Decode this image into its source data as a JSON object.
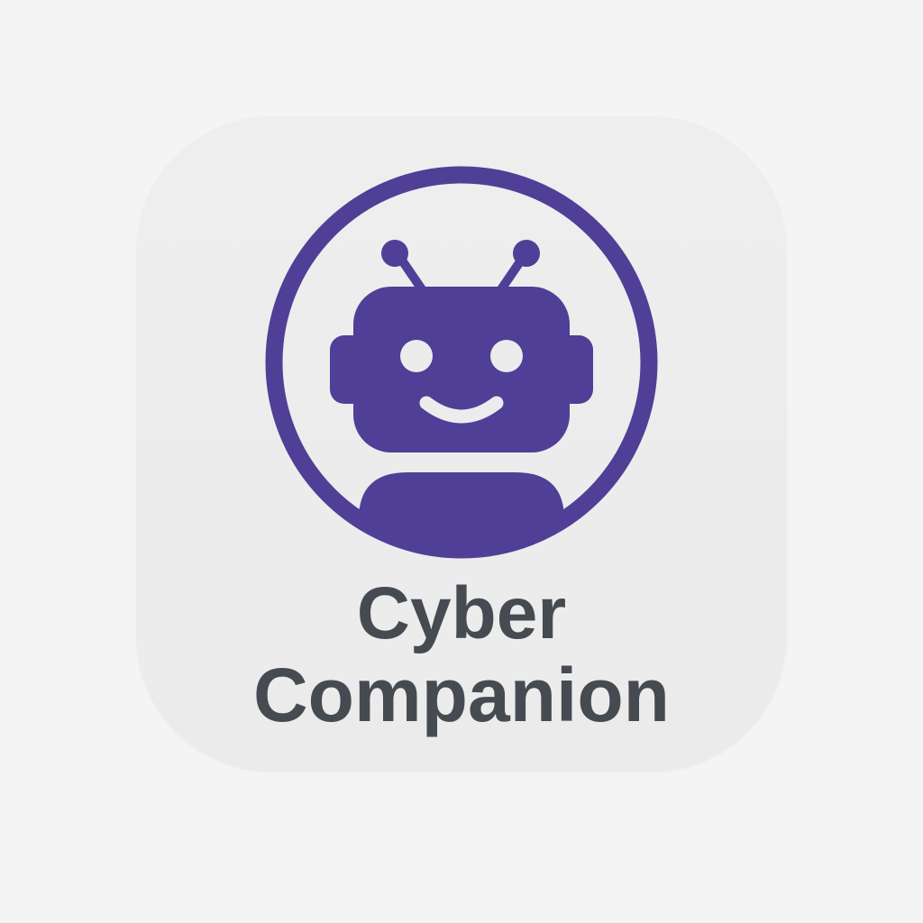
{
  "app_icon": {
    "name_line_1": "Cyber",
    "name_line_2": "Companion",
    "icon": "robot-avatar-icon",
    "colors": {
      "background": "#f4f4f4",
      "tile": "#ececec",
      "accent": "#503f96",
      "text": "#464b51"
    }
  }
}
